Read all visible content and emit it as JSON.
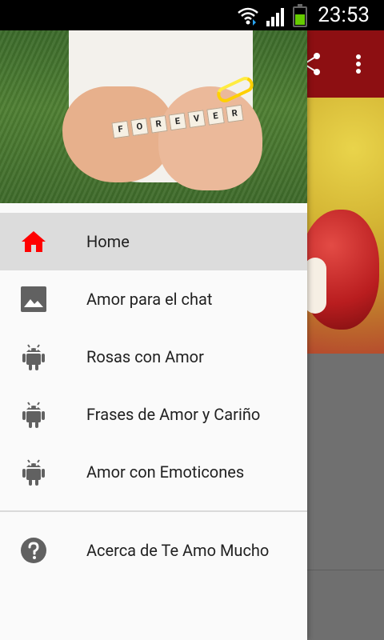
{
  "status_bar": {
    "time": "23:53",
    "icons": [
      "wifi-icon",
      "signal-icon",
      "battery-icon"
    ]
  },
  "header": {
    "image_label": "FOREVER"
  },
  "menu": {
    "items": [
      {
        "label": "Home",
        "icon": "home-icon",
        "selected": true
      },
      {
        "label": "Amor para el chat",
        "icon": "image-icon",
        "selected": false
      },
      {
        "label": "Rosas con Amor",
        "icon": "android-icon",
        "selected": false
      },
      {
        "label": "Frases de Amor y Cariño",
        "icon": "android-icon",
        "selected": false
      },
      {
        "label": "Amor con Emoticones",
        "icon": "android-icon",
        "selected": false
      }
    ],
    "secondary": [
      {
        "label": "Acerca de Te Amo Mucho",
        "icon": "help-icon"
      }
    ]
  },
  "colors": {
    "selected_icon": "#ff0000",
    "icon_gray": "#616161",
    "app_bar": "#8d0f12"
  },
  "background_app": {
    "actions": [
      "share-icon",
      "more-vert-icon"
    ]
  }
}
